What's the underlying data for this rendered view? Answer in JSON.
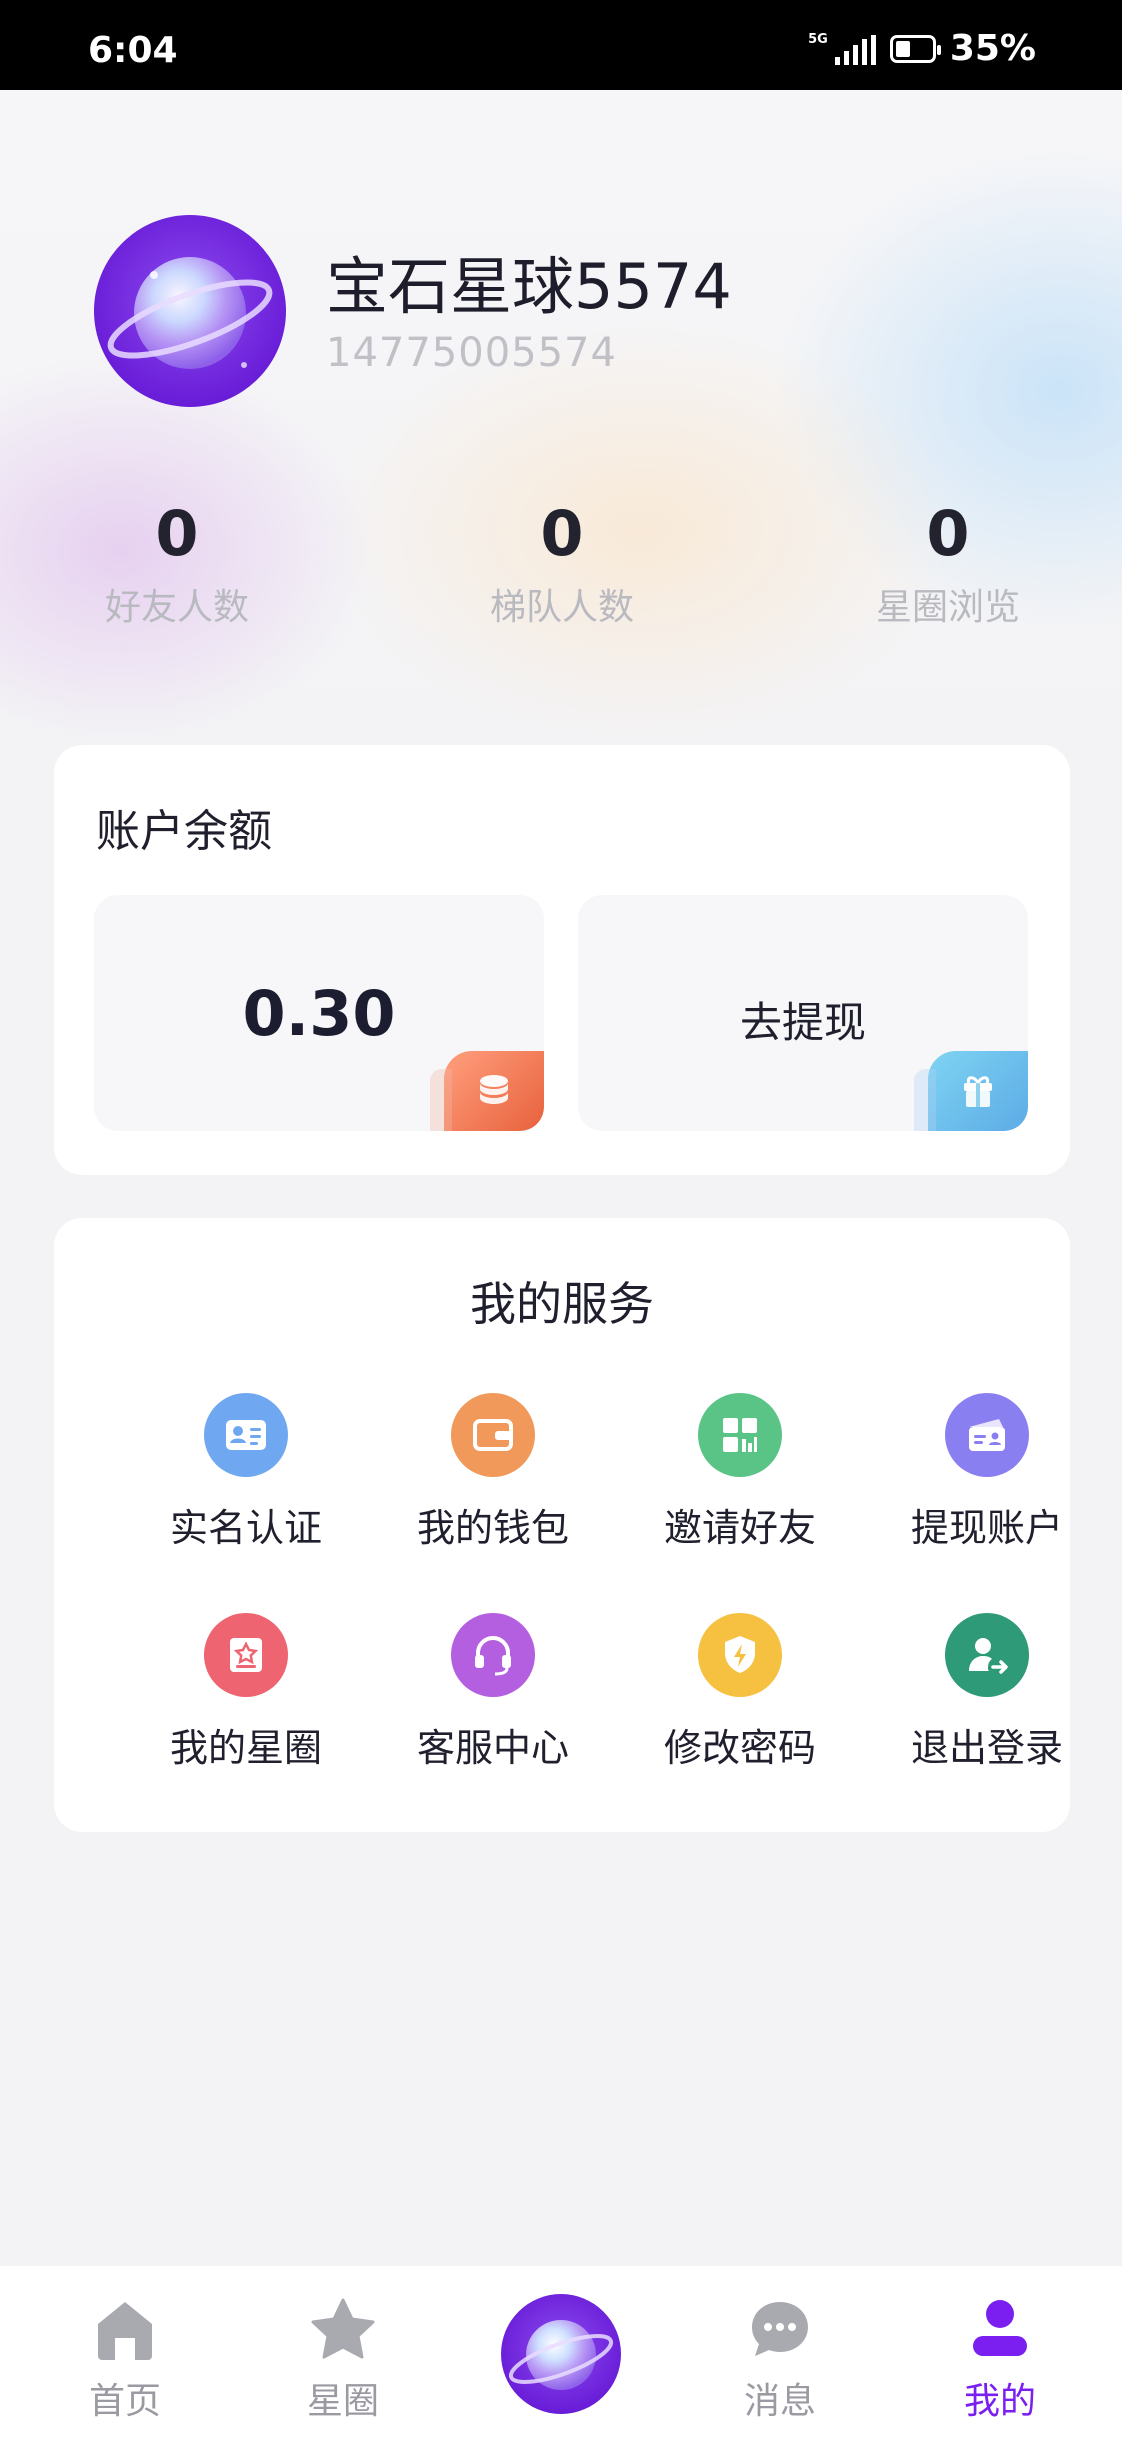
{
  "status_bar": {
    "time": "6:04",
    "network": "5G",
    "battery": "35%"
  },
  "profile": {
    "name": "宝石星球5574",
    "phone": "14775005574"
  },
  "stats": [
    {
      "value": "0",
      "label": "好友人数"
    },
    {
      "value": "0",
      "label": "梯队人数"
    },
    {
      "value": "0",
      "label": "星圈浏览"
    }
  ],
  "balance": {
    "title": "账户余额",
    "amount": "0.30",
    "withdraw_label": "去提现"
  },
  "services": {
    "title": "我的服务",
    "items": [
      {
        "label": "实名认证",
        "icon": "id-card-icon",
        "color": "#6fa8f0"
      },
      {
        "label": "我的钱包",
        "icon": "wallet-icon",
        "color": "#f0995a"
      },
      {
        "label": "邀请好友",
        "icon": "grid-qr-icon",
        "color": "#5ac486"
      },
      {
        "label": "提现账户",
        "icon": "account-card-icon",
        "color": "#8a7ff0"
      },
      {
        "label": "我的星圈",
        "icon": "star-badge-icon",
        "color": "#ee6470"
      },
      {
        "label": "客服中心",
        "icon": "headset-icon",
        "color": "#b45fe0"
      },
      {
        "label": "修改密码",
        "icon": "shield-bolt-icon",
        "color": "#f6c040"
      },
      {
        "label": "退出登录",
        "icon": "user-logout-icon",
        "color": "#2e9a78"
      }
    ]
  },
  "tabbar": {
    "items": [
      {
        "label": "首页",
        "icon": "home-icon"
      },
      {
        "label": "星圈",
        "icon": "star-icon"
      },
      {
        "label": "",
        "icon": "planet-icon"
      },
      {
        "label": "消息",
        "icon": "chat-icon"
      },
      {
        "label": "我的",
        "icon": "user-icon",
        "active": true
      }
    ],
    "active_color": "#7a1ff0",
    "inactive_color": "#9a9aa2"
  }
}
